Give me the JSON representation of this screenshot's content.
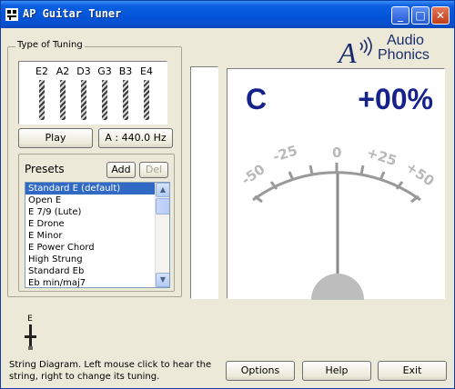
{
  "window": {
    "title": "AP Guitar Tuner"
  },
  "tuning": {
    "group_label": "Type of Tuning",
    "strings": [
      "E2",
      "A2",
      "D3",
      "G3",
      "B3",
      "E4"
    ],
    "play_label": "Play",
    "freq_label": "A : 440.0 Hz"
  },
  "presets": {
    "title": "Presets",
    "add_label": "Add",
    "del_label": "Del",
    "items": [
      "Standard E (default)",
      "Open E",
      "E 7/9 (Lute)",
      "E Drone",
      "E Minor",
      "E Power Chord",
      "High Strung",
      "Standard Eb",
      "Eb min/maj7"
    ],
    "selected_index": 0
  },
  "mini_diagram": {
    "label": "E"
  },
  "status": {
    "text": "String Diagram.  Left mouse click to hear the string, right to change its tuning."
  },
  "meter": {
    "note": "C",
    "cents": "+00%",
    "scale_labels": [
      "-50",
      "-25",
      "0",
      "+25",
      "+50"
    ]
  },
  "logo": {
    "line1": "Audio",
    "line2": "Phonics"
  },
  "buttons": {
    "options": "Options",
    "help": "Help",
    "exit": "Exit"
  },
  "colors": {
    "titlebar": "#0454d8",
    "selection": "#316ac5",
    "meter_text": "#15228a"
  }
}
